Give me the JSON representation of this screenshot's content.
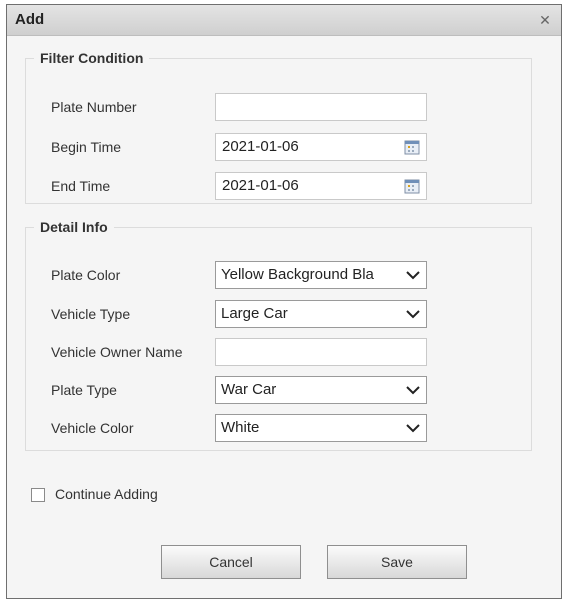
{
  "dialog": {
    "title": "Add",
    "close_icon": "close-icon"
  },
  "filter": {
    "legend": "Filter Condition",
    "plate_number_label": "Plate Number",
    "plate_number_value": "",
    "begin_time_label": "Begin Time",
    "begin_time_value": "2021-01-06",
    "end_time_label": "End Time",
    "end_time_value": "2021-01-06",
    "calendar_icon": "calendar-icon"
  },
  "detail": {
    "legend": "Detail Info",
    "plate_color_label": "Plate Color",
    "plate_color_value": "Yellow Background Bla",
    "vehicle_type_label": "Vehicle Type",
    "vehicle_type_value": "Large Car",
    "owner_name_label": "Vehicle Owner Name",
    "owner_name_value": "",
    "plate_type_label": "Plate Type",
    "plate_type_value": "War Car",
    "vehicle_color_label": "Vehicle Color",
    "vehicle_color_value": "White"
  },
  "options": {
    "continue_adding_label": "Continue Adding",
    "continue_adding_checked": false
  },
  "buttons": {
    "cancel_label": "Cancel",
    "save_label": "Save"
  }
}
